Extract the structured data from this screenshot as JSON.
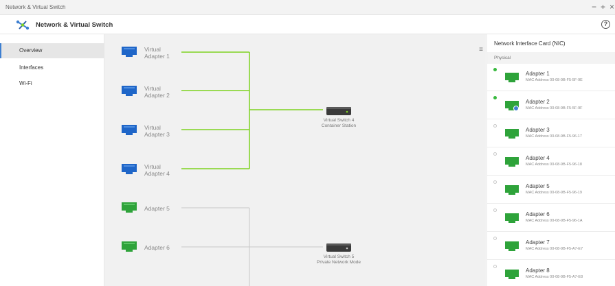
{
  "window": {
    "title": "Network & Virtual Switch",
    "controls": [
      "−",
      "+",
      "×"
    ]
  },
  "header": {
    "title": "Network & Virtual Switch",
    "help_icon": "?",
    "colors": {
      "accent": "#3d7fd1",
      "active_link": "#7ed321",
      "nic_green": "#2ea33a",
      "virtual_blue": "#1f66c8"
    }
  },
  "sidebar": {
    "items": [
      {
        "label": "Overview"
      },
      {
        "label": "Interfaces"
      },
      {
        "label": "Wi-Fi"
      }
    ]
  },
  "topology": {
    "virtual_adapters": [
      {
        "label_line1": "Virtual",
        "label_line2": "Adapter 1",
        "icon": "virtual-adapter-icon"
      },
      {
        "label_line1": "Virtual",
        "label_line2": "Adapter 2",
        "icon": "virtual-adapter-icon"
      },
      {
        "label_line1": "Virtual",
        "label_line2": "Adapter 3",
        "icon": "virtual-adapter-icon"
      },
      {
        "label_line1": "Virtual",
        "label_line2": "Adapter 4",
        "icon": "virtual-adapter-icon"
      }
    ],
    "physical_adapters": [
      {
        "label": "Adapter 5",
        "icon": "network-adapter-icon"
      },
      {
        "label": "Adapter 6",
        "icon": "network-adapter-icon"
      }
    ],
    "switches": [
      {
        "name": "Virtual Switch 4",
        "mode": "Container Station",
        "icon": "switch-icon"
      },
      {
        "name": "Virtual Switch 5",
        "mode": "Private Network Mode",
        "icon": "switch-icon"
      }
    ]
  },
  "nic_panel": {
    "title": "Network Interface Card (NIC)",
    "subtitle": "Physical",
    "adapters": [
      {
        "name": "Adapter 1",
        "mac": "MAC Address 00-08-9B-F5-5F-9E",
        "connected": true,
        "badge": false
      },
      {
        "name": "Adapter 2",
        "mac": "MAC Address 00-08-9B-F5-5F-9F",
        "connected": true,
        "badge": true
      },
      {
        "name": "Adapter 3",
        "mac": "MAC Address 00-08-9B-F5-96-17",
        "connected": false,
        "badge": false
      },
      {
        "name": "Adapter 4",
        "mac": "MAC Address 00-08-9B-F5-96-18",
        "connected": false,
        "badge": false
      },
      {
        "name": "Adapter 5",
        "mac": "MAC Address 00-08-9B-F5-96-19",
        "connected": false,
        "badge": false
      },
      {
        "name": "Adapter 6",
        "mac": "MAC Address 00-08-9B-F5-96-1A",
        "connected": false,
        "badge": false
      },
      {
        "name": "Adapter 7",
        "mac": "MAC Address 00-08-9B-F5-A7-E7",
        "connected": false,
        "badge": false
      },
      {
        "name": "Adapter 8",
        "mac": "MAC Address 00-08-9B-F5-A7-E8",
        "connected": false,
        "badge": false
      }
    ]
  }
}
